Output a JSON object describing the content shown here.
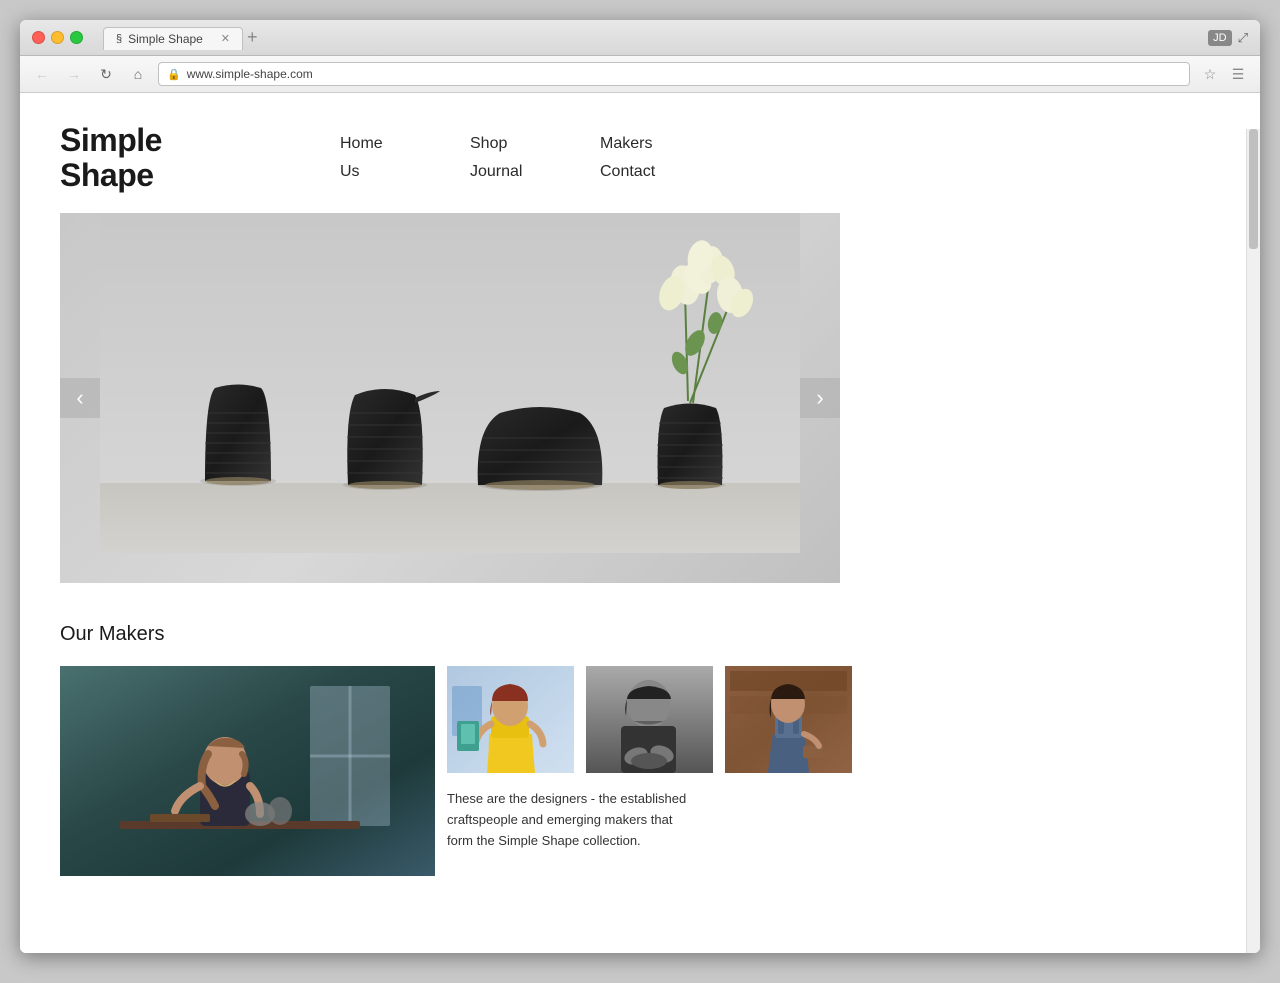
{
  "browser": {
    "tab_title": "Simple Shape",
    "url": "www.simple-shape.com",
    "user_initials": "JD",
    "back_btn": "←",
    "forward_btn": "→"
  },
  "site": {
    "logo_line1": "Simple",
    "logo_line2": "Shape",
    "nav": {
      "col1": {
        "link1": "Home",
        "link2": "Us"
      },
      "col2": {
        "link1": "Shop",
        "link2": "Journal"
      },
      "col3": {
        "link1": "Makers",
        "link2": "Contact"
      }
    },
    "slider": {
      "prev_label": "‹",
      "next_label": "›"
    },
    "makers": {
      "section_title": "Our Makers",
      "description": "These are the designers - the established craftspeople and emerging makers that form the Simple Shape collection."
    }
  }
}
